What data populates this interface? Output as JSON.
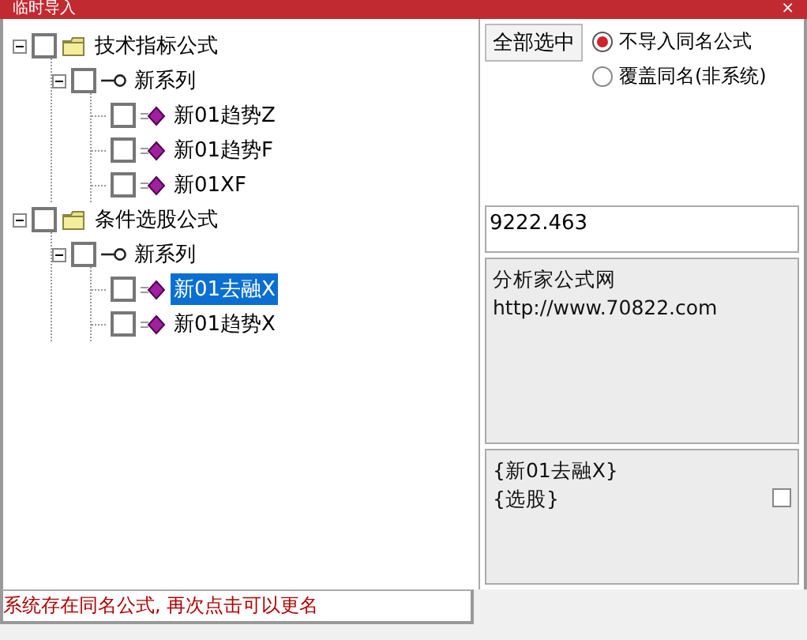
{
  "window": {
    "title": "临时导入",
    "close": "×"
  },
  "tree": [
    {
      "label": "技术指标公式",
      "kind": "folder",
      "expanded": true,
      "checked": false,
      "selected": false,
      "children": [
        {
          "label": "新系列",
          "kind": "series",
          "expanded": true,
          "checked": false,
          "selected": false,
          "children": [
            {
              "label": "新01趋势Z",
              "kind": "formula",
              "checked": false,
              "selected": false
            },
            {
              "label": "新01趋势F",
              "kind": "formula",
              "checked": false,
              "selected": false
            },
            {
              "label": "新01XF",
              "kind": "formula",
              "checked": false,
              "selected": false
            }
          ]
        }
      ]
    },
    {
      "label": "条件选股公式",
      "kind": "folder",
      "expanded": true,
      "checked": false,
      "selected": false,
      "children": [
        {
          "label": "新系列",
          "kind": "series",
          "expanded": true,
          "checked": false,
          "selected": false,
          "children": [
            {
              "label": "新01去融X",
              "kind": "formula",
              "checked": false,
              "selected": true
            },
            {
              "label": "新01趋势X",
              "kind": "formula",
              "checked": false,
              "selected": false
            }
          ]
        }
      ]
    }
  ],
  "select_all_button": "全部选中",
  "import_options": [
    {
      "label": "不导入同名公式",
      "selected": true
    },
    {
      "label": "覆盖同名(非系统)",
      "selected": false
    }
  ],
  "value_field": {
    "value": "9222.463"
  },
  "description": {
    "lines": [
      "分析家公式网",
      "http://www.70822.com"
    ]
  },
  "formula_info": {
    "lines": [
      "{新01去融X}",
      "{选股}"
    ],
    "checked": false
  },
  "status_message": "系统存在同名公式, 再次点击可以更名"
}
